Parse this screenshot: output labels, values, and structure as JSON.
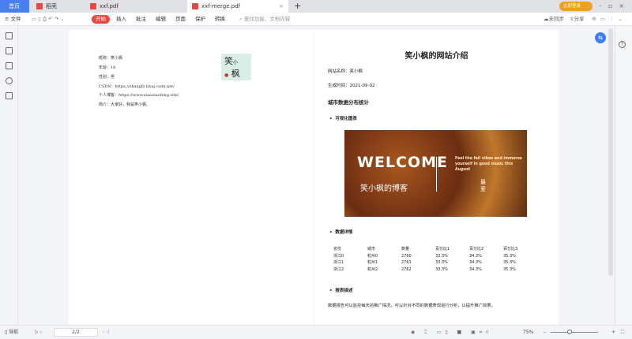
{
  "tabs": [
    {
      "label": "首页",
      "active": false
    },
    {
      "label": "稻壳"
    },
    {
      "label": "xxf.pdf"
    },
    {
      "label": "xxf-merge.pdf",
      "active": true
    }
  ],
  "window": {
    "login_label": "立即登录",
    "accent": "#f0a020"
  },
  "toolbar": {
    "menu": "文件",
    "items": [
      "开始",
      "插入",
      "批注",
      "编辑",
      "页面",
      "保护",
      "转换"
    ],
    "active_item": "开始",
    "search_placeholder": "查找功能、文档内容",
    "sync": "未同步",
    "share": "分享",
    "start_color": "#e8483f"
  },
  "left_page": {
    "lines": [
      "昵称：笑小枫",
      "年龄：18",
      "性别：男",
      "CSDN：https://zhangfz.blog.csdn.net/",
      "个人博客：https://www.xiaoxiaofeng.site/",
      "简介：大家好，我是笑小枫。"
    ],
    "logo_text": "笑小枫"
  },
  "right_page": {
    "title": "笑小枫的网站介绍",
    "site_name": "网站名称：笑小枫",
    "gen_time": "生成时间：2021-09-02",
    "section": "城市数据分布统计",
    "bullet1": "可视化图表",
    "banner": {
      "welcome": "WELCOME",
      "subtitle": "笑小枫的博客",
      "tagline": "Feel the fall vibes and immerse yourself in good music this August",
      "side": "最爱"
    },
    "bullet2": "数据详情",
    "table": {
      "headers": [
        "省份",
        "城市",
        "数量",
        "百分比1",
        "百分比2",
        "百分比3"
      ],
      "rows": [
        [
          "浙江0",
          "杭州0",
          "2760",
          "33.3%",
          "34.3%",
          "35.3%"
        ],
        [
          "浙江1",
          "杭州1",
          "2761",
          "33.3%",
          "34.3%",
          "35.3%"
        ],
        [
          "浙江2",
          "杭州2",
          "2762",
          "33.3%",
          "34.3%",
          "35.3%"
        ]
      ]
    },
    "bullet3": "报表描述",
    "description": "数据报告可以监控每天的推广情况，可以针对不同的数据表现进行分析，以提升推广效果。"
  },
  "status": {
    "nav": "导航",
    "page": "2/2",
    "zoom": "75%"
  }
}
